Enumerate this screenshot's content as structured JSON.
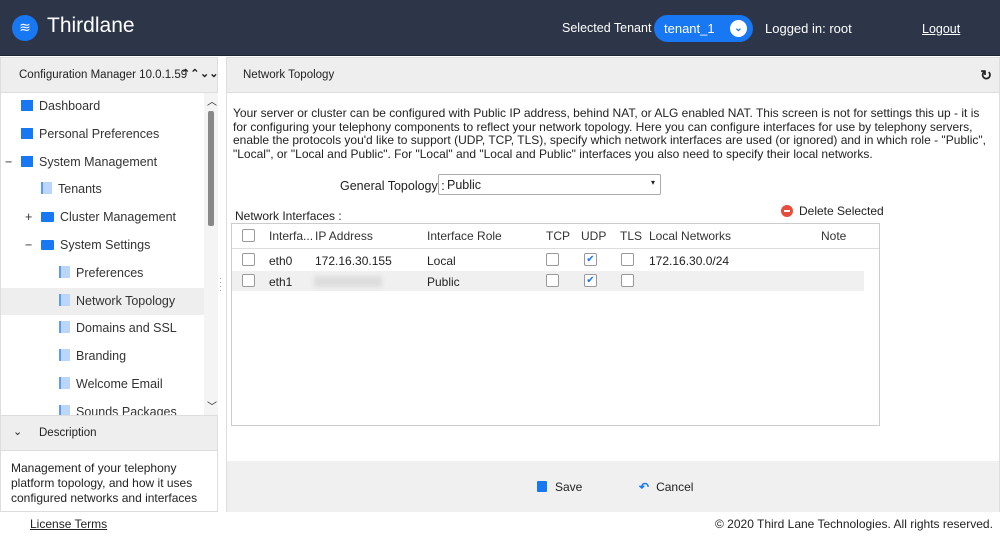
{
  "header": {
    "brand": "Thirdlane",
    "tenant_label": "Selected Tenant :",
    "tenant_value": "tenant_1",
    "logged_in": "Logged in: root",
    "logout": "Logout"
  },
  "sidebar": {
    "title": "Configuration Manager 10.0.1.59",
    "items": [
      {
        "label": "Dashboard",
        "icon": "chart-icon"
      },
      {
        "label": "Personal Preferences",
        "icon": "edit-icon"
      },
      {
        "label": "System Management",
        "icon": "window-icon",
        "toggle": "−"
      },
      {
        "label": "Tenants",
        "icon": "document-icon"
      },
      {
        "label": "Cluster Management",
        "icon": "folder-icon",
        "toggle": "+"
      },
      {
        "label": "System Settings",
        "icon": "folder-open-icon",
        "toggle": "−"
      },
      {
        "label": "Preferences",
        "icon": "document-icon"
      },
      {
        "label": "Network Topology",
        "icon": "document-icon",
        "selected": true
      },
      {
        "label": "Domains and SSL",
        "icon": "document-icon"
      },
      {
        "label": "Branding",
        "icon": "document-icon"
      },
      {
        "label": "Welcome Email",
        "icon": "document-icon"
      },
      {
        "label": "Sounds Packages",
        "icon": "document-icon"
      }
    ],
    "description_title": "Description",
    "description": "Management of your telephony platform topology, and how it uses configured networks and interfaces"
  },
  "main": {
    "title": "Network Topology",
    "intro": "Your server or cluster can be configured with Public IP address, behind NAT, or ALG enabled NAT. This screen is not for settings this up - it is for configuring your telephony components to reflect your network topology. Here you can configure interfaces for use by telephony servers, enable the protocols you'd like to support (UDP, TCP, TLS), specify which network interfaces are used (or ignored) and in which role - \"Public\", \"Local\", or \"Local and Public\". For \"Local\" and \"Local and Public\" interfaces you also need to specify their local networks.",
    "general_topology_label": "General Topology :",
    "general_topology_value": "Public",
    "interfaces_label": "Network Interfaces :",
    "delete_selected": "Delete Selected",
    "columns": [
      "Interfa...",
      "IP Address",
      "Interface Role",
      "TCP",
      "UDP",
      "TLS",
      "Local Networks",
      "Note"
    ],
    "rows": [
      {
        "interface": "eth0",
        "ip": "172.16.30.155",
        "role": "Local",
        "tcp": false,
        "udp": true,
        "tls": false,
        "local_networks": "172.16.30.0/24",
        "note": ""
      },
      {
        "interface": "eth1",
        "ip": "",
        "role": "Public",
        "tcp": false,
        "udp": true,
        "tls": false,
        "local_networks": "",
        "note": ""
      }
    ],
    "save": "Save",
    "cancel": "Cancel"
  },
  "footer": {
    "license": "License Terms",
    "copyright": "© 2020 Third Lane Technologies. All rights reserved."
  },
  "colors": {
    "header_bg": "#2d3649",
    "accent": "#1877f2",
    "delete": "#e74c3c"
  }
}
